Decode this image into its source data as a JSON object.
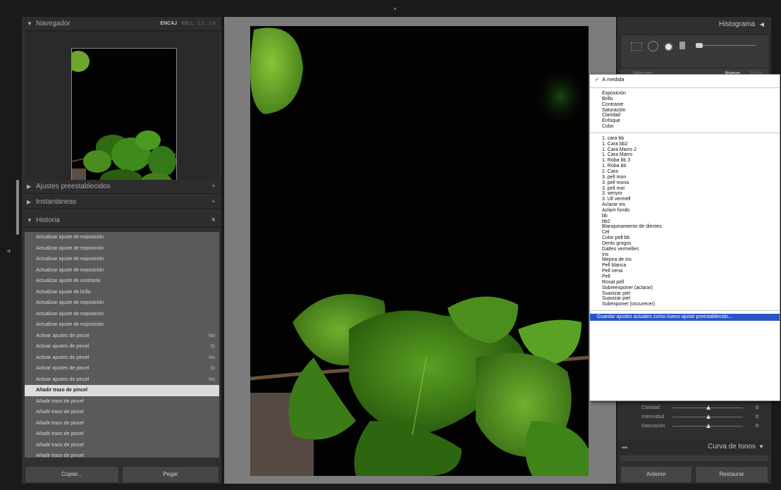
{
  "navigator": {
    "title": "Navegador",
    "zoom_options": [
      "ENCAJ",
      "RELL",
      "1:1",
      "1:4"
    ]
  },
  "panels": {
    "presets": "Ajustes preestablecidos",
    "snapshots": "Instantáneas",
    "history": "Historia",
    "add_symbol": "+",
    "close_symbol": "×"
  },
  "history": [
    {
      "label": "Actualizar ajuste de exposición",
      "value": ""
    },
    {
      "label": "Actualizar ajuste de exposición",
      "value": ""
    },
    {
      "label": "Actualizar ajuste de exposición",
      "value": ""
    },
    {
      "label": "Actualizar ajuste de exposición",
      "value": ""
    },
    {
      "label": "Actualizar ajuste de contraste",
      "value": ""
    },
    {
      "label": "Actualizar ajuste de brillo",
      "value": ""
    },
    {
      "label": "Actualizar ajuste de exposición",
      "value": ""
    },
    {
      "label": "Actualizar ajuste de exposición",
      "value": ""
    },
    {
      "label": "Actualizar ajuste de exposición",
      "value": ""
    },
    {
      "label": "Activar ajustes de pincel",
      "value": "No"
    },
    {
      "label": "Activar ajustes de pincel",
      "value": "Sí"
    },
    {
      "label": "Activar ajustes de pincel",
      "value": "No"
    },
    {
      "label": "Activar ajustes de pincel",
      "value": "Sí"
    },
    {
      "label": "Activar ajustes de pincel",
      "value": "No"
    },
    {
      "label": "Añadir trazo de pincel",
      "value": "",
      "selected": true
    },
    {
      "label": "Añadir trazo de pincel",
      "value": ""
    },
    {
      "label": "Añadir trazo de pincel",
      "value": ""
    },
    {
      "label": "Añadir trazo de pincel",
      "value": ""
    },
    {
      "label": "Añadir trazo de pincel",
      "value": ""
    },
    {
      "label": "Añadir trazo de pincel",
      "value": ""
    },
    {
      "label": "Añadir trazo de pincel",
      "value": ""
    }
  ],
  "left_buttons": {
    "copy": "Copiar...",
    "paste": "Pegar"
  },
  "right_panel": {
    "histogram_title": "Histograma",
    "mask_label": "Máscara:",
    "mask_new": "Nuevo",
    "mask_edit": "Editar",
    "sliders": [
      {
        "label": "Claridad",
        "value": "0"
      },
      {
        "label": "Intensidad",
        "value": "0"
      },
      {
        "label": "Saturación",
        "value": "0"
      }
    ],
    "tone_curve": "Curva de tonos",
    "prev_button": "Anterior",
    "reset_button": "Restaurar"
  },
  "dropdown": {
    "selected": "A medida",
    "group1": [
      "Exposición",
      "Brillo",
      "Contraste",
      "Saturación",
      "Claridad",
      "Enfoque",
      "Color"
    ],
    "group2": [
      "1. cara bb",
      "1. Cara bb2",
      "1. Cara Marro 2",
      "1. Cara Marro",
      "1. Roba bb 3",
      "1. Roba bb",
      "2. Cara",
      "3. pell mon",
      "3. pell mona",
      "3. pell mol",
      "3. senyor",
      "3. Ull vermell",
      "Aclarar iris",
      "Aclarir fondo",
      "bb",
      "bb2",
      "Blanqueamiento de dientes",
      "Cel",
      "Color pell bb",
      "Dents grogos",
      "Galtes vermelles",
      "Iris",
      "Mejora de iris",
      "Pell blanca",
      "Pell nena",
      "Pell",
      "Rosat pell",
      "Sobreexponer (aclarar)",
      "Suavizar piel",
      "Suavizar piel",
      "Subexponer (oscurecer)"
    ],
    "save_item": "Guardar ajustes actuales como nuevo ajuste preestablecido..."
  },
  "colors": {
    "selected_menu_item": "#2a55c8",
    "panel": "#303030",
    "history_bg": "#5a5a5a"
  }
}
